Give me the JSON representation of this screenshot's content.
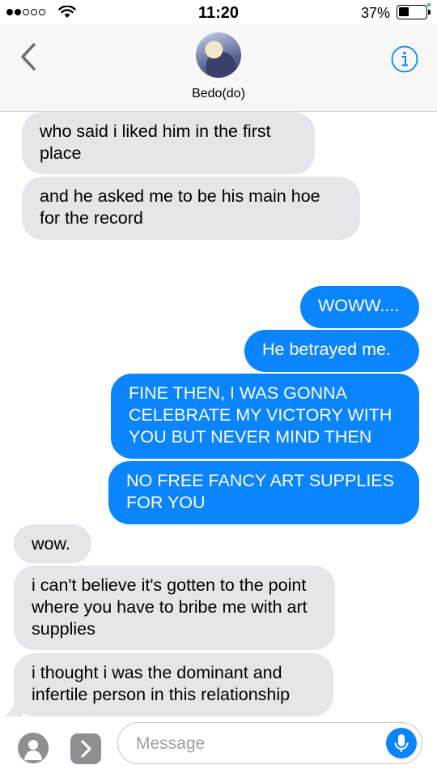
{
  "status_bar": {
    "time": "11:20",
    "battery_percent": "37%",
    "battery_level": 0.37,
    "signal_bars": 2
  },
  "header": {
    "contact_name": "Bedo(do)",
    "back_icon": "chevron-left-icon",
    "info_icon": "info-circle-icon"
  },
  "messages": [
    {
      "from": "them",
      "text": "who said i liked him in the first place"
    },
    {
      "from": "them",
      "text": "and he asked me to be his main hoe for the record"
    },
    {
      "from": "me",
      "text": "WOWW...."
    },
    {
      "from": "me",
      "text": "He betrayed me."
    },
    {
      "from": "me",
      "text": "FINE THEN, I WAS GONNA CELEBRATE MY VICTORY WITH YOU BUT NEVER MIND THEN"
    },
    {
      "from": "me",
      "text": "NO FREE FANCY ART SUPPLIES FOR YOU"
    },
    {
      "from": "them",
      "text": "wow."
    },
    {
      "from": "them",
      "text": "i can't believe it's gotten to the point where you have to bribe me with art supplies"
    },
    {
      "from": "them",
      "text": "i thought i was the dominant and infertile person in this relationship"
    }
  ],
  "composer": {
    "placeholder": "Message",
    "value": ""
  },
  "colors": {
    "accent": "#0a84ff",
    "incoming_bubble": "#e5e5ea",
    "header_bg": "#f7f7f7"
  }
}
